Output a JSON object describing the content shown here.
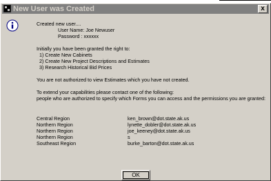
{
  "window": {
    "title": "New User was Created",
    "close_label": "x"
  },
  "icons": {
    "info": "info-icon",
    "app": "app-icon"
  },
  "message": {
    "created": "Created new user....",
    "user_name": "User Name: Joe Newuser",
    "password": "Password : xxxxxx",
    "rights_intro": "Initially you have been granted the right to:",
    "rights": [
      "1) Create New Cabinets",
      "2) Create New Project Descriptions and Estimates",
      "3) Research Historical Bid Prices"
    ],
    "not_authorized": "You are  not authorized to view Estimates which you have not created.",
    "extend_1": "To extend your capabilities please contact one of the following:",
    "extend_2": " people who are authorized to specify which Forms you can access and the permissions you are granted:"
  },
  "contacts": [
    {
      "region": "Central Region",
      "email": "ken_brown@dot.state.ak.us"
    },
    {
      "region": "Northern Region",
      "email": "lynette_dobler@dot.state.ak.us"
    },
    {
      "region": "Northern Region",
      "email": "joe_keeney@dot.state.ak.us"
    },
    {
      "region": "Northern Region",
      "email": "s"
    },
    {
      "region": "Southeast Region",
      "email": "burke_barton@dot.state.ak.us"
    }
  ],
  "buttons": {
    "ok": "OK"
  }
}
